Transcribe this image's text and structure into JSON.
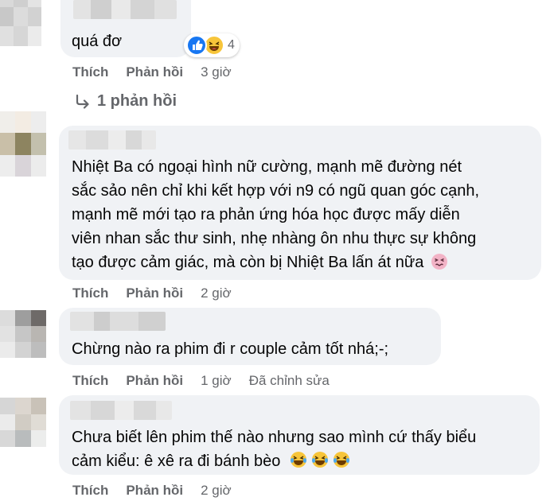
{
  "comments": [
    {
      "text_lines": [
        "quá đơ"
      ],
      "reactions": {
        "count": "4",
        "icons": [
          "like-reaction-icon",
          "haha-reaction-icon"
        ]
      },
      "actions": {
        "like": "Thích",
        "reply": "Phản hồi",
        "time": "3 giờ"
      },
      "replies_link": "1 phản hồi"
    },
    {
      "text_lines": [
        "Nhiệt Ba có ngoại hình nữ cường, mạnh mẽ đường nét",
        "sắc sảo nên chỉ khi kết hợp với n9 có ngũ quan góc cạnh,",
        "mạnh mẽ mới tạo ra phản ứng hóa học được mấy diễn",
        "viên nhan sắc thư sinh, nhẹ nhàng ôn nhu thực sự không",
        "tạo được cảm giác, mà còn bị Nhiệt Ba lấn át nữa"
      ],
      "emoji": "persevering-face-emoji",
      "actions": {
        "like": "Thích",
        "reply": "Phản hồi",
        "time": "2 giờ"
      }
    },
    {
      "text_lines": [
        "Chừng nào ra phim đi r couple cảm tốt nhá;-;"
      ],
      "actions": {
        "like": "Thích",
        "reply": "Phản hồi",
        "time": "1 giờ",
        "edited": "Đã chỉnh sửa"
      }
    },
    {
      "text_lines": [
        "Chưa biết lên phim thế nào nhưng sao mình cứ thấy biểu",
        "cảm kiểu: ê xê ra đi bánh bèo"
      ],
      "emoji": "laughing-tears-emoji",
      "actions": {
        "like": "Thích",
        "reply": "Phản hồi",
        "time": "2 giờ"
      }
    }
  ],
  "colors": {
    "bubble": "#f0f2f5",
    "meta_text": "#65676b",
    "like_blue": "#1877f2",
    "haha_yellow": "#f7c53a"
  }
}
